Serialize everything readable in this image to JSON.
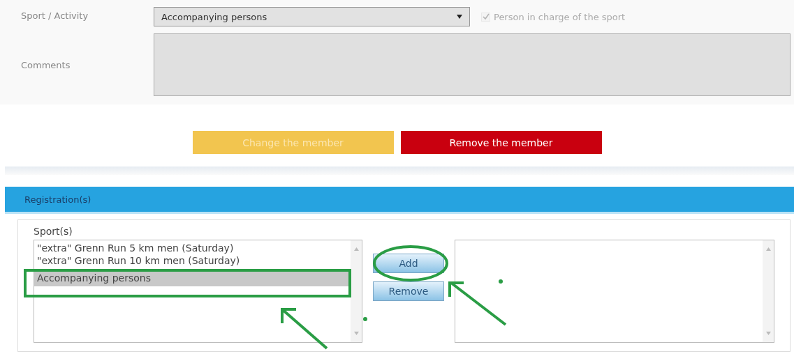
{
  "sport_field": {
    "label": "Sport / Activity",
    "value": "Accompanying persons",
    "checkbox": {
      "label": "Person in charge of the sport",
      "checked": true,
      "disabled": true
    }
  },
  "comments_field": {
    "label": "Comments"
  },
  "actions": [
    {
      "label": "Change the member",
      "kind": "warning",
      "disabled": true
    },
    {
      "label": "Remove the member",
      "kind": "danger",
      "disabled": false
    }
  ],
  "registrations": {
    "title": "Registration(s)",
    "list_label": "Sport(s)",
    "available": [
      {
        "label": "\"extra\" Grenn Run 5 km men (Saturday)",
        "selected": false
      },
      {
        "label": "\"extra\" Grenn Run 10 km men (Saturday)",
        "selected": false
      },
      {
        "label": "Accompanying persons",
        "selected": true
      }
    ],
    "buttons": [
      "Add",
      "Remove"
    ]
  }
}
